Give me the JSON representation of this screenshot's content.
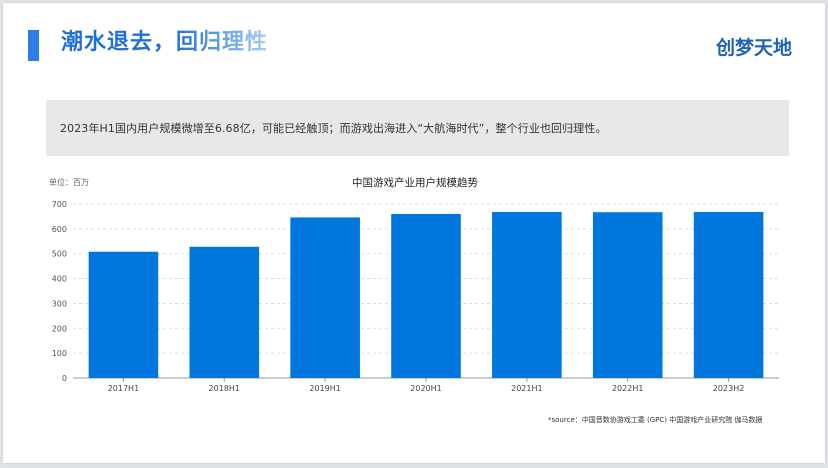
{
  "header": {
    "title": "潮水退去，回归理性",
    "logo": "创梦天地"
  },
  "summary": "2023年H1国内用户规模微增至6.68亿，可能已经触顶；而游戏出海进入“大航海时代”，整个行业也回归理性。",
  "footer": {
    "source": "*source：中国音数协游戏工委 (GPC) 中国游戏产业研究院 伽马数据"
  },
  "colors": {
    "accent": "#2f7ee8",
    "title_gradient_start": "#1f6fd8",
    "title_gradient_end": "#a8cff5",
    "logo": "#1f63b8",
    "bar": "#0077dd",
    "summary_bg": "#e8e8e8"
  },
  "chart_data": {
    "type": "bar",
    "title": "中国游戏产业用户规模趋势",
    "unit_label": "单位：百万",
    "categories": [
      "2017H1",
      "2018H1",
      "2019H1",
      "2020H1",
      "2021H1",
      "2022H1",
      "2023H2"
    ],
    "values": [
      508,
      528,
      646,
      660,
      668,
      667,
      668
    ],
    "ylim": [
      0,
      700
    ],
    "yticks": [
      0,
      100,
      200,
      300,
      400,
      500,
      600,
      700
    ],
    "grid": true,
    "legend": "none"
  }
}
